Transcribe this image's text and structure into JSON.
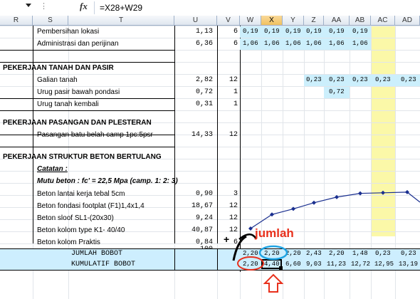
{
  "formula_bar": {
    "formula": "=X28+W29",
    "fx_label": "fx"
  },
  "columns": [
    "R",
    "S",
    "T",
    "U",
    "V",
    "W",
    "X",
    "Y",
    "Z",
    "AA",
    "AB",
    "AC",
    "AD"
  ],
  "selected_column": "X",
  "rows": [
    {
      "label": "Pembersihan lokasi",
      "weight": "1,13",
      "duration": "6"
    },
    {
      "label": "Administrasi dan perijinan",
      "weight": "6,36",
      "duration": "6"
    },
    {
      "heading": "PEKERJAAN TANAH DAN PASIR"
    },
    {
      "label": "Galian tanah",
      "weight": "2,82",
      "duration": "12"
    },
    {
      "label": "Urug pasir bawah pondasi",
      "weight": "0,72",
      "duration": "1"
    },
    {
      "label": "Urug tanah kembali",
      "weight": "0,31",
      "duration": "1"
    },
    {
      "heading": "PEKERJAAN PASANGAN DAN PLESTERAN"
    },
    {
      "label": "Pasangan batu belah camp 1pc:5psr",
      "weight": "14,33",
      "duration": "12"
    },
    {
      "heading": "PEKERJAAN STRUKTUR BETON BERTULANG"
    },
    {
      "note": "Catatan :"
    },
    {
      "note2": "Mutu beton : fc' = 22,5 Mpa  (camp. 1: 2: 3)"
    },
    {
      "label": "Beton lantai kerja tebal 5cm",
      "weight": "0,90",
      "duration": "3"
    },
    {
      "label": "Beton fondasi footplat (F1)1,4x1,4",
      "weight": "18,67",
      "duration": "12"
    },
    {
      "label": "Beton sloof SL1-(20x30)",
      "weight": "9,24",
      "duration": "12"
    },
    {
      "label": "Beton kolom type K1- 40/40",
      "weight": "40,87",
      "duration": "12"
    },
    {
      "label": "Beton kolom Praktis",
      "weight": "0,84",
      "duration": "6"
    }
  ],
  "total_weight": "100",
  "schedule": {
    "row1": [
      "0,19",
      "0,19",
      "0,19",
      "0,19",
      "0,19",
      "0,19"
    ],
    "row2": [
      "1,06",
      "1,06",
      "1,06",
      "1,06",
      "1,06",
      "1,06"
    ],
    "galian": [
      "0,23",
      "0,23",
      "0,23",
      "0,23",
      "0,23"
    ],
    "urug_pasir": "0,72"
  },
  "footer": {
    "jumlah_label": "JUMLAH BOBOT",
    "kumulatif_label": "KUMULATIF BOBOT",
    "jumlah": [
      "2,20",
      "2,20",
      "2,20",
      "2,43",
      "2,20",
      "1,48",
      "0,23",
      "0,23"
    ],
    "kumulatif": [
      "2,20",
      "4,40",
      "6,60",
      "9,03",
      "11,23",
      "12,72",
      "12,95",
      "13,19"
    ]
  },
  "annotation": {
    "text": "jumlah",
    "color": "#e8301c"
  },
  "chart_data": {
    "type": "line",
    "series": [
      {
        "values": [
          2.2,
          4.4,
          6.6,
          9.03,
          11.23,
          12.72,
          12.95,
          13.19
        ]
      }
    ],
    "categories": [
      "W",
      "X",
      "Y",
      "Z",
      "AA",
      "AB",
      "AC",
      "AD"
    ]
  }
}
